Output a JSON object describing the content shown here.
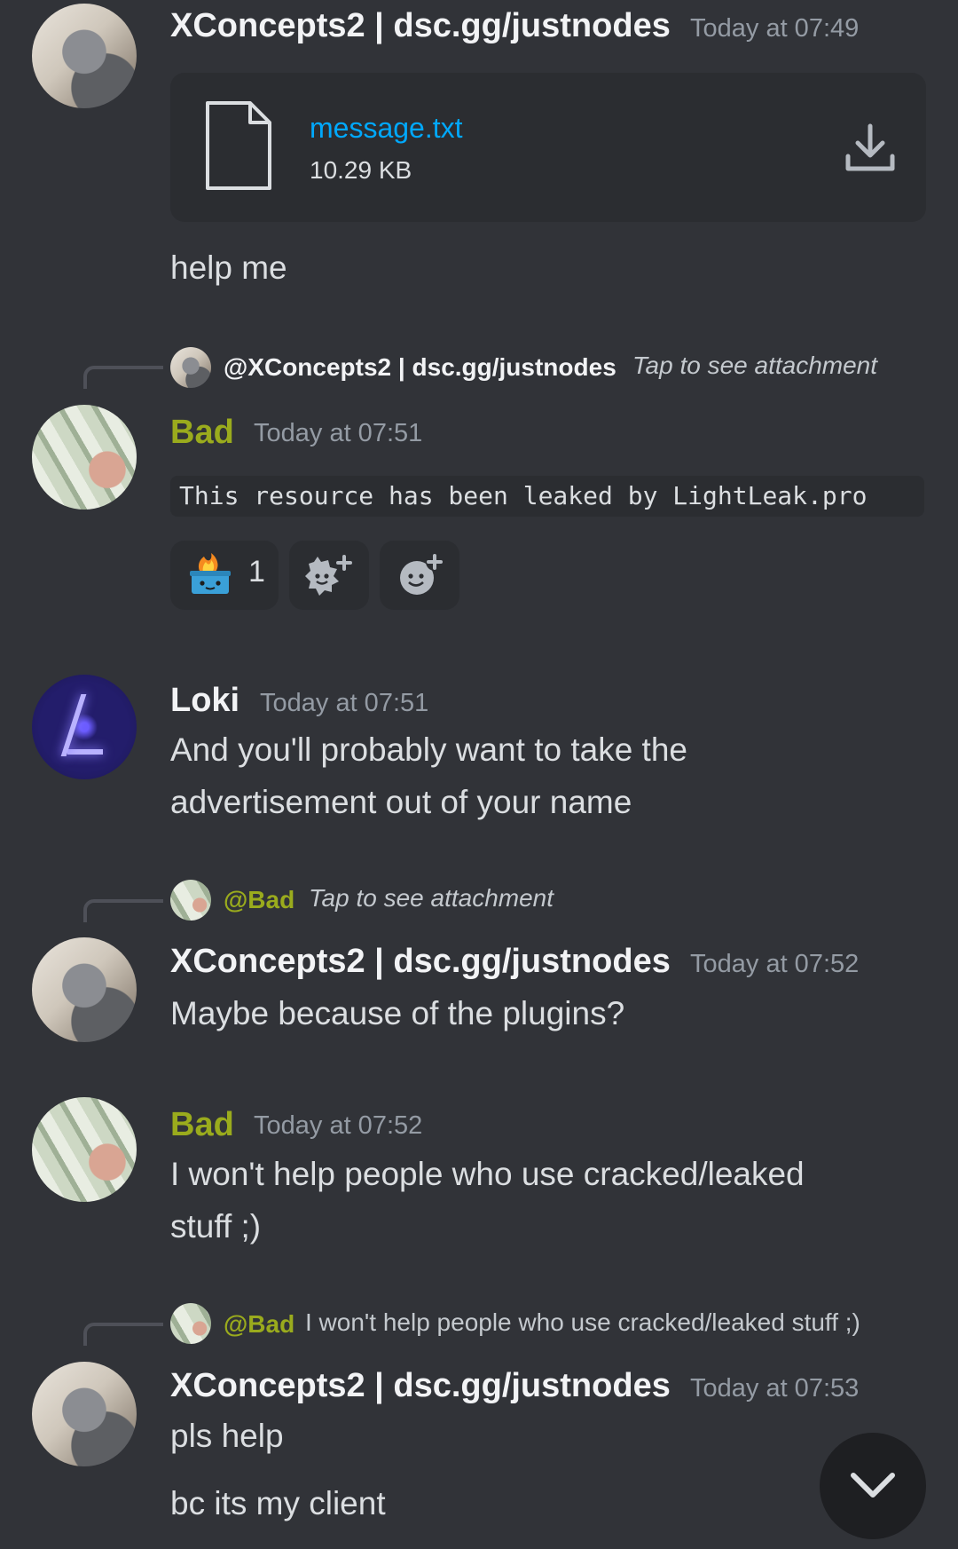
{
  "messages": {
    "m1": {
      "username": "XConcepts2 | dsc.gg/justnodes",
      "timestamp": "Today at 07:49",
      "attachment": {
        "filename": "message.txt",
        "size": "10.29 KB"
      },
      "text": "help me"
    },
    "m2": {
      "reply": {
        "name": "@XConcepts2 | dsc.gg/justnodes",
        "text": "Tap to see attachment"
      },
      "username": "Bad",
      "timestamp": "Today at 07:51",
      "code": "This resource has been leaked by LightLeak.pro",
      "reactions": [
        {
          "icon": "dumpster-fire-emoji",
          "count": "1"
        },
        {
          "icon": "add-super-reaction-icon"
        },
        {
          "icon": "add-reaction-icon"
        }
      ]
    },
    "m3": {
      "username": "Loki",
      "timestamp": "Today at 07:51",
      "line1": "And you'll probably want to take the",
      "line2": "advertisement out of your name"
    },
    "m4": {
      "reply": {
        "name": "@Bad",
        "text": "Tap to see attachment"
      },
      "username": "XConcepts2 | dsc.gg/justnodes",
      "timestamp": "Today at 07:52",
      "text": "Maybe because of the plugins?"
    },
    "m5": {
      "username": "Bad",
      "timestamp": "Today at 07:52",
      "line1": "I won't help people who use cracked/leaked",
      "line2": "stuff ;)"
    },
    "m6": {
      "reply": {
        "name": "@Bad",
        "text": "I won't help people who use cracked/leaked stuff ;)"
      },
      "username": "XConcepts2 | dsc.gg/justnodes",
      "timestamp": "Today at 07:53",
      "text1": "pls help",
      "text2": "bc its my client"
    }
  },
  "colors": {
    "background": "#313338",
    "username_white": "#f2f3f5",
    "username_olive": "#9aab1d",
    "link_blue": "#00a8fc",
    "muted": "#949ba4"
  },
  "controls": {
    "scroll_icon": "chevron-down-icon"
  }
}
